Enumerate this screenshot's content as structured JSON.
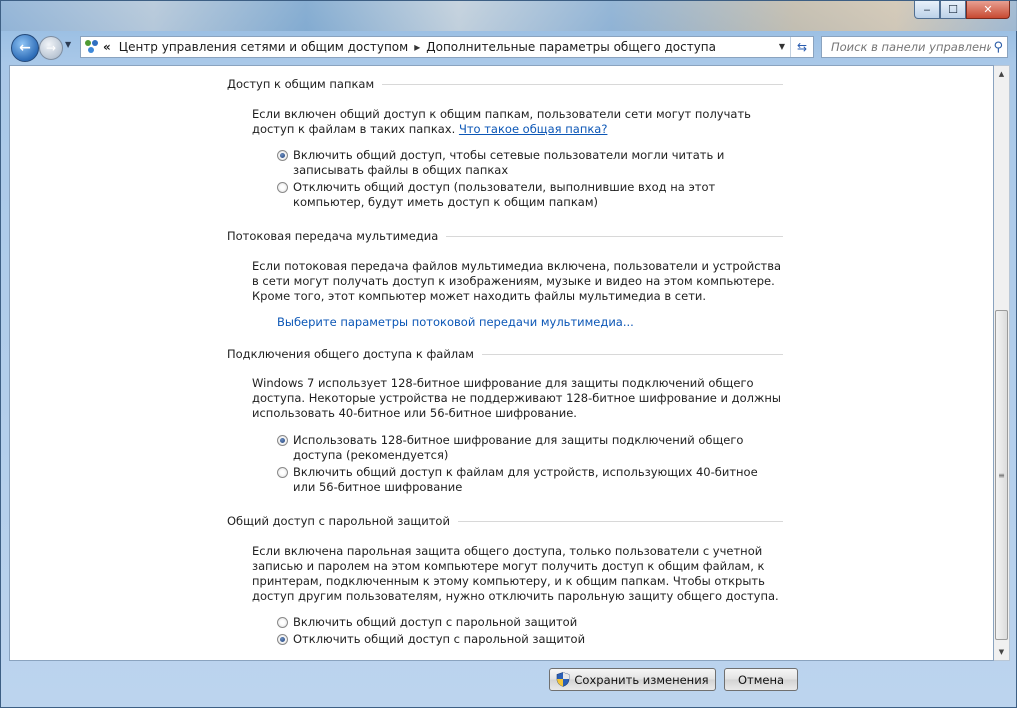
{
  "window": {
    "controls": {
      "minimize": "‒",
      "maximize": "☐",
      "close": "✕"
    }
  },
  "nav": {
    "back_icon": "←",
    "forward_icon": "→",
    "crumb_prefix": "«",
    "breadcrumb": [
      "Центр управления сетями и общим доступом",
      "Дополнительные параметры общего доступа"
    ],
    "crumb_separator": "▸",
    "search_placeholder": "Поиск в панели управления"
  },
  "sections": {
    "public_folders": {
      "title": "Доступ к общим папкам",
      "desc": "Если включен общий доступ к общим папкам, пользователи сети могут получать доступ к файлам в таких папках.",
      "link": "Что такое общая папка?",
      "option_on": "Включить общий доступ, чтобы сетевые пользователи могли читать и записывать файлы в общих папках",
      "option_off": "Отключить общий доступ (пользователи, выполнившие вход на этот компьютер, будут иметь доступ к общим папкам)",
      "selected": "on"
    },
    "media_streaming": {
      "title": "Потоковая передача мультимедиа",
      "desc": "Если потоковая передача файлов мультимедиа включена, пользователи и устройства в сети могут получать доступ к изображениям, музыке и видео на этом компьютере. Кроме того, этот компьютер может находить файлы мультимедиа в сети.",
      "link": "Выберите параметры потоковой передачи мультимедиа..."
    },
    "file_sharing": {
      "title": "Подключения общего доступа к файлам",
      "desc": "Windows 7 использует 128-битное шифрование для защиты подключений общего доступа. Некоторые устройства не поддерживают 128-битное шифрование и должны использовать 40-битное или 56-битное шифрование.",
      "option_128": "Использовать 128-битное шифрование для защиты подключений общего доступа (рекомендуется)",
      "option_40": "Включить общий доступ к файлам для устройств, использующих 40-битное или 56-битное шифрование",
      "selected": "128"
    },
    "password": {
      "title": "Общий доступ с парольной защитой",
      "desc": "Если включена парольная защита общего доступа, только пользователи с учетной записью и паролем на этом компьютере могут получить доступ к общим файлам, к принтерам, подключенным к этому компьютеру, и к общим папкам. Чтобы открыть доступ другим пользователям, нужно отключить парольную защиту общего доступа.",
      "option_on": "Включить общий доступ с парольной защитой",
      "option_off": "Отключить общий доступ с парольной защитой",
      "selected": "off"
    }
  },
  "footer": {
    "save_label": "Сохранить изменения",
    "cancel_label": "Отмена"
  },
  "colors": {
    "link": "#0b56b6",
    "accent": "#2e6db8"
  }
}
